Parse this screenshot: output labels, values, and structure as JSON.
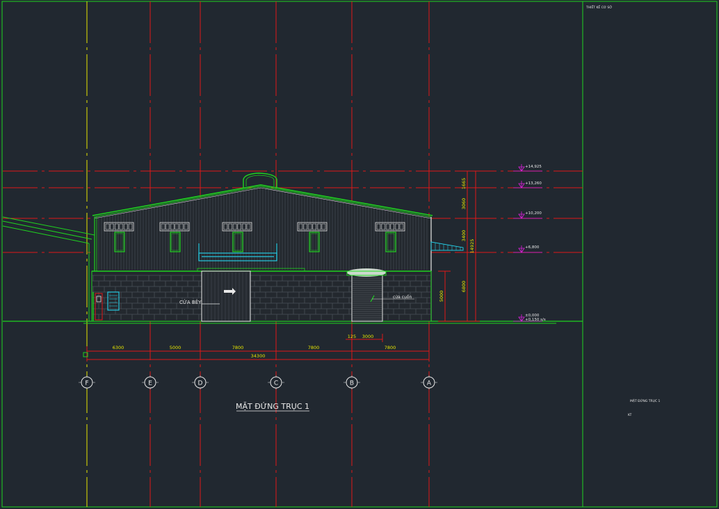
{
  "drawing": {
    "title": "MẶT ĐỨNG TRỤC 1",
    "sidebar_header": "THIẾT KẾ CƠ SỞ",
    "sidebar_title": "MẶT ĐỨNG TRỤC 1",
    "sidebar_code": "KT"
  },
  "annotations": {
    "door_label": "CỬA BÊY",
    "door_label_2": "cửa cuốn"
  },
  "elevations": {
    "e1": "+14,925",
    "e2": "+13,260",
    "e3": "+10,200",
    "e4": "+6,800",
    "e5": "±0,000",
    "e6": "+0,150 s/s"
  },
  "vertical_dims": {
    "d1": "1665",
    "d2": "3060",
    "d3": "3400",
    "d4": "6800",
    "d5": "5000",
    "total": "14925"
  },
  "horizontal_dims": {
    "spans": [
      "6300",
      "5000",
      "7800",
      "7800",
      "7800"
    ],
    "total": "34300",
    "small_a": "125",
    "small_b": "3000"
  },
  "axes": [
    "F",
    "E",
    "D",
    "C",
    "B",
    "A"
  ],
  "colors": {
    "background": "#212830",
    "frame": "#1fd31f",
    "grid_line": "#e01818",
    "axis_yellow": "#e6e600",
    "elevation_magenta": "#e020e0",
    "cyan": "#25c8e0",
    "white": "#e8e8e8"
  }
}
